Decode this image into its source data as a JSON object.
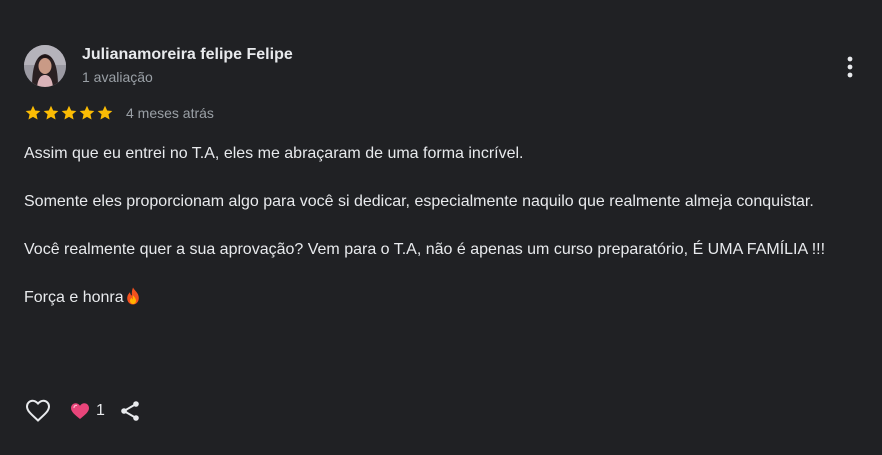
{
  "review": {
    "author_name": "Julianamoreira felipe Felipe",
    "author_meta": "1 avaliação",
    "rating": 5,
    "rating_max": 5,
    "date": "4 meses atrás",
    "paragraphs": [
      "Assim que eu entrei no T.A, eles me abraçaram de uma forma incrível.",
      "Somente eles proporcionam algo para você si dedicar, especialmente naquilo que realmente almeja conquistar.",
      "Você realmente quer a sua aprovação? Vem para o T.A, não é apenas um curso preparatório, É UMA FAMÍLIA !!!",
      "Força e honra"
    ],
    "reaction_count": "1"
  },
  "icons": {
    "more": "more-vertical-icon",
    "star": "star-icon",
    "fire": "fire-emoji-icon",
    "like": "heart-outline-icon",
    "reaction": "heart-emoji-icon",
    "share": "share-icon"
  },
  "colors": {
    "background": "#202124",
    "text_primary": "#e8eaed",
    "text_secondary": "#9aa0a6",
    "star": "#fbbc04",
    "reaction_heart": "#e8457a"
  }
}
